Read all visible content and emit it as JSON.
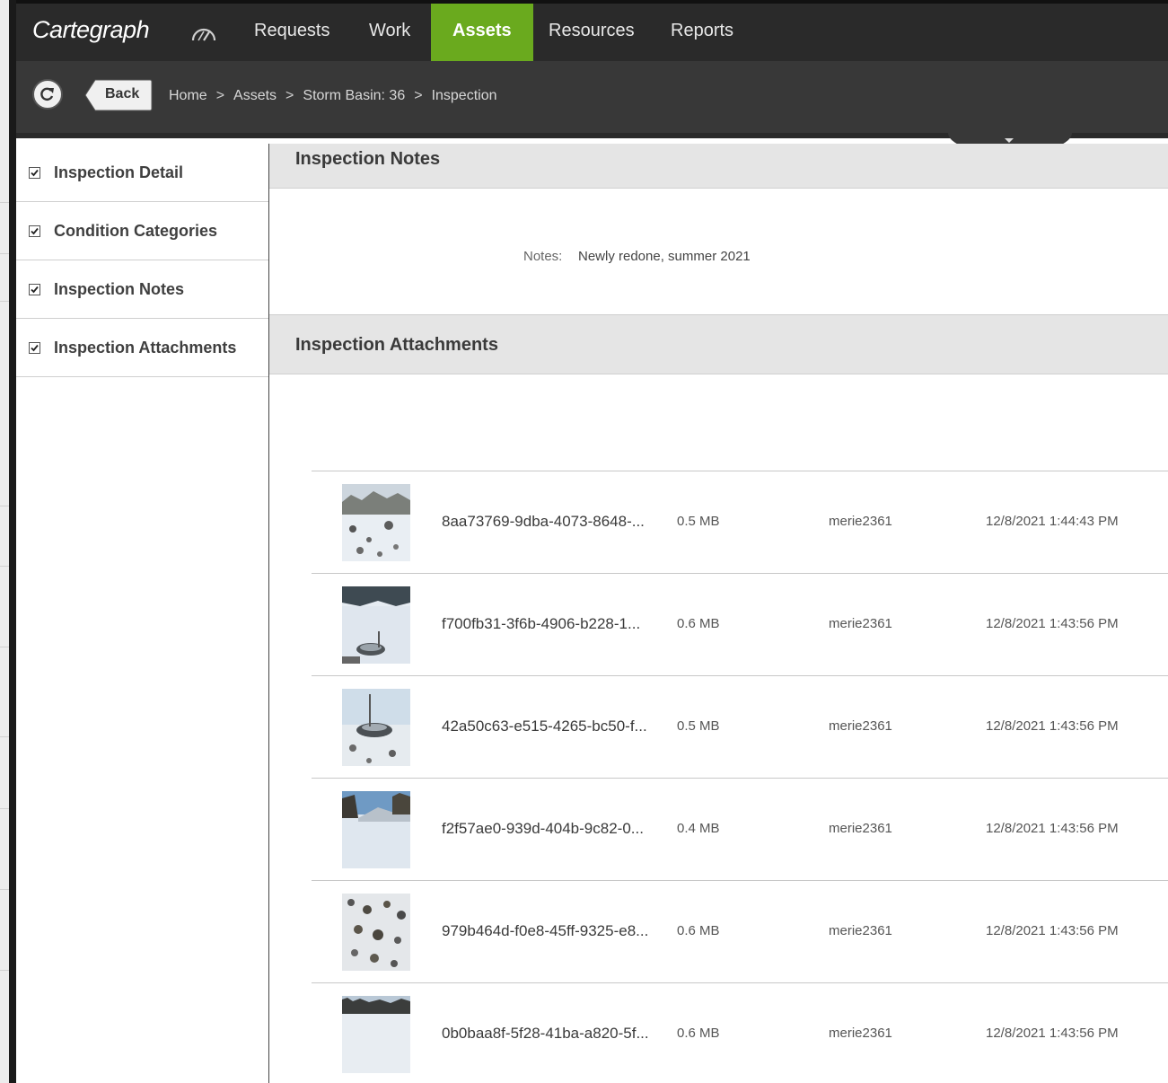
{
  "app": {
    "logo": "Cartegraph"
  },
  "nav": {
    "tabs": [
      {
        "label": "Requests"
      },
      {
        "label": "Work"
      },
      {
        "label": "Assets",
        "active": true
      },
      {
        "label": "Resources"
      },
      {
        "label": "Reports"
      }
    ]
  },
  "toolbar": {
    "back_label": "Back"
  },
  "breadcrumb": [
    "Home",
    "Assets",
    "Storm Basin: 36",
    "Inspection"
  ],
  "breadcrumb_separator": ">",
  "sidebar": {
    "items": [
      {
        "label": "Inspection Detail",
        "checked": true
      },
      {
        "label": "Condition Categories",
        "checked": true
      },
      {
        "label": "Inspection Notes",
        "checked": true
      },
      {
        "label": "Inspection Attachments",
        "checked": true
      }
    ]
  },
  "notes_section": {
    "title": "Inspection Notes",
    "label": "Notes:",
    "value": "Newly redone, summer 2021"
  },
  "attachments_section": {
    "title": "Inspection Attachments",
    "rows": [
      {
        "name": "8aa73769-9dba-4073-8648-...",
        "size": "0.5 MB",
        "user": "merie2361",
        "date": "12/8/2021 1:44:43 PM"
      },
      {
        "name": "f700fb31-3f6b-4906-b228-1...",
        "size": "0.6 MB",
        "user": "merie2361",
        "date": "12/8/2021 1:43:56 PM"
      },
      {
        "name": "42a50c63-e515-4265-bc50-f...",
        "size": "0.5 MB",
        "user": "merie2361",
        "date": "12/8/2021 1:43:56 PM"
      },
      {
        "name": "f2f57ae0-939d-404b-9c82-0...",
        "size": "0.4 MB",
        "user": "merie2361",
        "date": "12/8/2021 1:43:56 PM"
      },
      {
        "name": "979b464d-f0e8-45ff-9325-e8...",
        "size": "0.6 MB",
        "user": "merie2361",
        "date": "12/8/2021 1:43:56 PM"
      },
      {
        "name": "0b0baa8f-5f28-41ba-a820-5f...",
        "size": "0.6 MB",
        "user": "merie2361",
        "date": "12/8/2021 1:43:56 PM"
      }
    ]
  },
  "colors": {
    "accent": "#6aaa1e",
    "nav_bg": "#2a2a2a",
    "crumb_bg": "#383838"
  },
  "icons": {
    "dashboard": "gauge-icon",
    "refresh": "refresh-icon",
    "check": "checkmark-icon"
  }
}
